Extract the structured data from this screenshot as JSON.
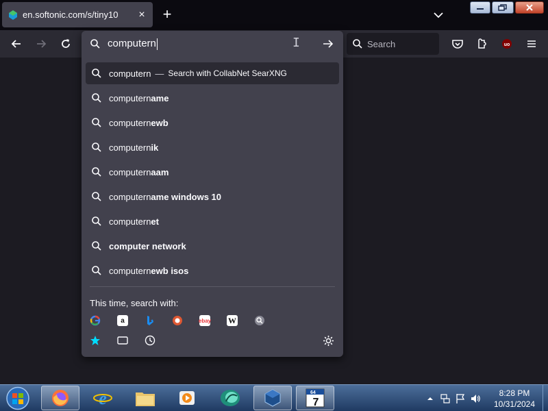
{
  "tab": {
    "title": "en.softonic.com/s/tiny10"
  },
  "urlbar": {
    "typed": "computern",
    "first_row": {
      "query": "computern",
      "separator": "—",
      "engine_text": "Search with CollabNet SearXNG"
    },
    "suggestions": [
      {
        "prefix": "computern",
        "suffix": "ame"
      },
      {
        "prefix": "computern",
        "suffix": "ewb"
      },
      {
        "prefix": "computern",
        "suffix": "ik"
      },
      {
        "prefix": "computern",
        "suffix": "aam"
      },
      {
        "prefix": "computern",
        "suffix": "ame windows 10"
      },
      {
        "prefix": "computern",
        "suffix": "et"
      },
      {
        "prefix": "",
        "suffix": "computer network"
      },
      {
        "prefix": "computern",
        "suffix": "ewb isos"
      }
    ],
    "this_time_label": "This time, search with:",
    "engines": [
      "google-icon",
      "amazon-icon",
      "bing-icon",
      "duckduckgo-icon",
      "ebay-icon",
      "wikipedia-icon",
      "searxng-icon"
    ],
    "modes": [
      "bookmarks-icon",
      "tabs-icon",
      "history-icon"
    ]
  },
  "search": {
    "placeholder": "Search"
  },
  "taskbar": {
    "time": "8:28 PM",
    "date": "10/31/2024",
    "apps": [
      "firefox-icon",
      "internet-explorer-icon",
      "explorer-icon",
      "media-player-icon",
      "app-icon",
      "virtualbox-icon",
      "7zip-icon"
    ]
  },
  "colors": {
    "accent": "#00ddff",
    "panel": "#42414d",
    "toolbar": "#2b2a33",
    "background": "#1c1b22"
  }
}
